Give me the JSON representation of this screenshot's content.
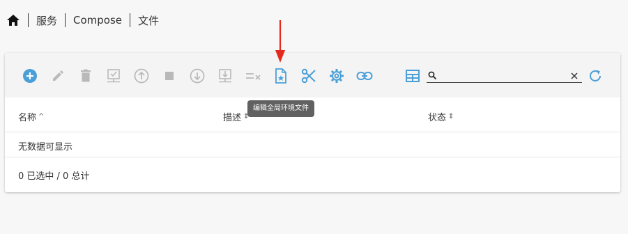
{
  "breadcrumb": {
    "items": [
      "服务",
      "Compose",
      "文件"
    ]
  },
  "toolbar": {
    "buttons": [
      {
        "name": "add",
        "icon": "plus-circle-icon",
        "color": "#4a9fd8",
        "enabled": true
      },
      {
        "name": "edit",
        "icon": "pencil-icon",
        "color": "#b9b9b9",
        "enabled": false
      },
      {
        "name": "delete",
        "icon": "trash-icon",
        "color": "#b9b9b9",
        "enabled": false
      },
      {
        "name": "deploy",
        "icon": "monitor-check-icon",
        "color": "#b9b9b9",
        "enabled": false
      },
      {
        "name": "start",
        "icon": "arrow-up-circle-icon",
        "color": "#b9b9b9",
        "enabled": false
      },
      {
        "name": "stop",
        "icon": "stop-square-icon",
        "color": "#b9b9b9",
        "enabled": false
      },
      {
        "name": "pull",
        "icon": "arrow-down-circle-icon",
        "color": "#b9b9b9",
        "enabled": false
      },
      {
        "name": "download",
        "icon": "download-tray-icon",
        "color": "#b9b9b9",
        "enabled": false
      },
      {
        "name": "clear",
        "icon": "list-x-icon",
        "color": "#b9b9b9",
        "enabled": false
      },
      {
        "name": "edit-env",
        "icon": "file-star-icon",
        "color": "#4a9fd8",
        "enabled": true
      },
      {
        "name": "cut",
        "icon": "scissors-icon",
        "color": "#4a9fd8",
        "enabled": true
      },
      {
        "name": "settings",
        "icon": "gear-icon",
        "color": "#4a9fd8",
        "enabled": true
      },
      {
        "name": "link",
        "icon": "link-icon",
        "color": "#4a9fd8",
        "enabled": true
      }
    ],
    "view_toggle_icon": "table-grid-icon",
    "refresh_icon": "refresh-icon",
    "search": {
      "placeholder": "",
      "value": ""
    }
  },
  "tooltip": {
    "text": "编辑全局环境文件"
  },
  "table": {
    "columns": [
      {
        "label": "名称",
        "sort": "^"
      },
      {
        "label": "描述",
        "sort": "⇕"
      },
      {
        "label": "状态",
        "sort": "⇕"
      }
    ],
    "empty_text": "无数据可显示",
    "footer": "0 已选中 / 0 总计"
  },
  "colors": {
    "accent": "#4a9fd8",
    "disabled": "#b9b9b9",
    "annotation": "#e32a1c"
  }
}
